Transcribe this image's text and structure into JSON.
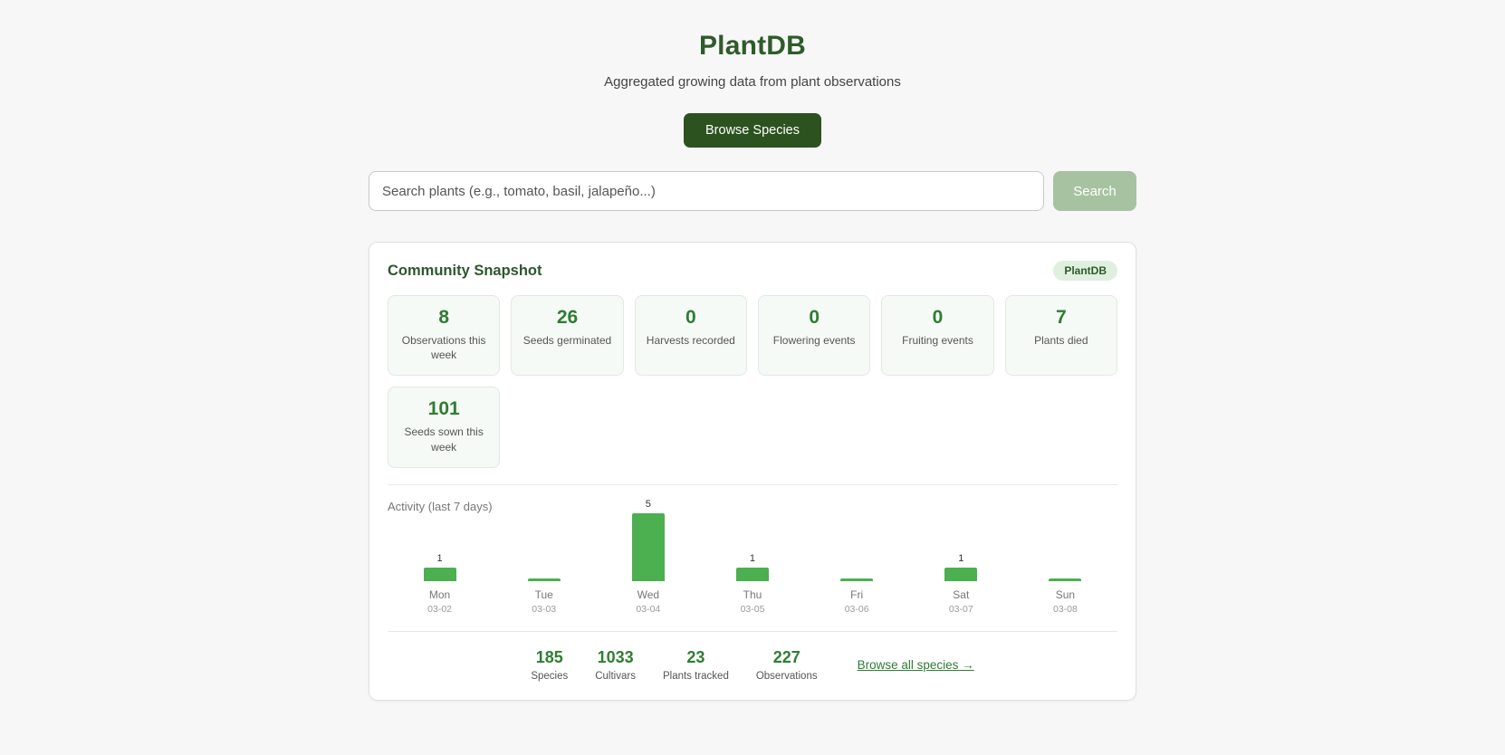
{
  "header": {
    "title": "PlantDB",
    "subtitle": "Aggregated growing data from plant observations",
    "browse_button": "Browse Species"
  },
  "search": {
    "placeholder": "Search plants (e.g., tomato, basil, jalapeño...)",
    "button": "Search"
  },
  "snapshot": {
    "title": "Community Snapshot",
    "badge": "PlantDB",
    "stats": [
      {
        "value": "8",
        "label": "Observations this week"
      },
      {
        "value": "26",
        "label": "Seeds germinated"
      },
      {
        "value": "0",
        "label": "Harvests recorded"
      },
      {
        "value": "0",
        "label": "Flowering events"
      },
      {
        "value": "0",
        "label": "Fruiting events"
      },
      {
        "value": "7",
        "label": "Plants died"
      },
      {
        "value": "101",
        "label": "Seeds sown this week"
      }
    ],
    "footer_stats": [
      {
        "value": "185",
        "label": "Species"
      },
      {
        "value": "1033",
        "label": "Cultivars"
      },
      {
        "value": "23",
        "label": "Plants tracked"
      },
      {
        "value": "227",
        "label": "Observations"
      }
    ],
    "browse_link": "Browse all species →"
  },
  "chart_data": {
    "type": "bar",
    "title": "Activity (last 7 days)",
    "categories": [
      "Mon",
      "Tue",
      "Wed",
      "Thu",
      "Fri",
      "Sat",
      "Sun"
    ],
    "dates": [
      "03-02",
      "03-03",
      "03-04",
      "03-05",
      "03-06",
      "03-07",
      "03-08"
    ],
    "values": [
      1,
      0,
      5,
      1,
      0,
      1,
      0
    ],
    "display_labels": [
      "1",
      "",
      "5",
      "1",
      "",
      "1",
      ""
    ],
    "ylim": [
      0,
      5
    ],
    "bar_color": "#4caf50",
    "grid": false,
    "legend": false
  }
}
